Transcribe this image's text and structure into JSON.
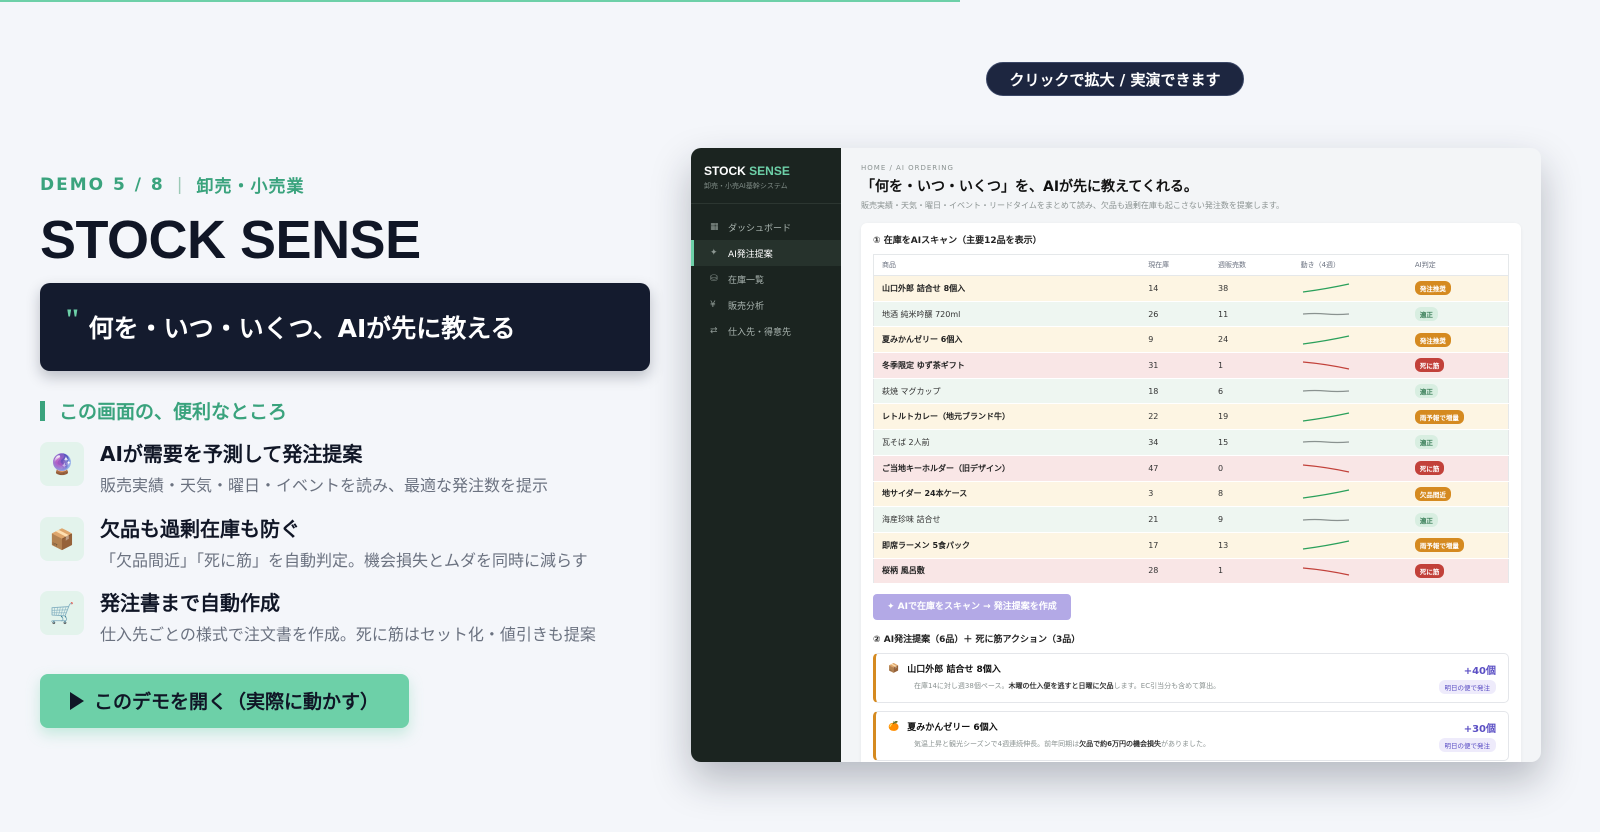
{
  "progress_fraction": 0.6,
  "left": {
    "eyebrow_demo": "DEMO 5 / 8",
    "eyebrow_sep": "|",
    "eyebrow_category": "卸売・小売業",
    "title": "STOCK SENSE",
    "quote_mark": "\"",
    "quote": "何を・いつ・いくつ、AIが先に教える",
    "section_title": "この画面の、便利なところ",
    "features": [
      {
        "icon": "crystal-ball-icon",
        "glyph": "🔮",
        "title": "AIが需要を予測して発注提案",
        "desc": "販売実績・天気・曜日・イベントを読み、最適な発注数を提示"
      },
      {
        "icon": "box-icon",
        "glyph": "📦",
        "title": "欠品も過剰在庫も防ぐ",
        "desc": "「欠品間近」「死に筋」を自動判定。機会損失とムダを同時に減らす"
      },
      {
        "icon": "cart-icon",
        "glyph": "🛒",
        "title": "発注書まで自動作成",
        "desc": "仕入先ごとの様式で注文書を作成。死に筋はセット化・値引きも提案"
      }
    ],
    "cta": "このデモを開く（実際に動かす）"
  },
  "tooltip": "クリックで拡大 / 実演できます",
  "app": {
    "brand_a": "STOCK",
    "brand_b": "SENSE",
    "brand_sub": "卸売・小売AI基幹システム",
    "nav": [
      {
        "icon": "▦",
        "label": "ダッシュボード",
        "active": false
      },
      {
        "icon": "✦",
        "label": "AI発注提案",
        "active": true
      },
      {
        "icon": "⛁",
        "label": "在庫一覧",
        "active": false
      },
      {
        "icon": "¥",
        "label": "販売分析",
        "active": false
      },
      {
        "icon": "⇄",
        "label": "仕入先・得意先",
        "active": false
      }
    ],
    "breadcrumb": "HOME / AI ORDERING",
    "heading": "「何を・いつ・いくつ」を、AIが先に教えてくれる。",
    "subheading": "販売実績・天気・曜日・イベント・リードタイムをまとめて読み、欠品も過剰在庫も起こさない発注数を提案します。",
    "scan_title": "① 在庫をAIスキャン（主要12品を表示）",
    "columns": [
      "商品",
      "現在庫",
      "週販売数",
      "動き（4週）",
      "AI判定"
    ],
    "rows": [
      {
        "name": "山口外郎 詰合せ 8個入",
        "stock": "14",
        "weekly": "38",
        "trend": "up",
        "status": "order",
        "label": "発注推奨"
      },
      {
        "name": "地酒 純米吟醸 720ml",
        "stock": "26",
        "weekly": "11",
        "trend": "flat",
        "status": "ok",
        "label": "適正"
      },
      {
        "name": "夏みかんゼリー 6個入",
        "stock": "9",
        "weekly": "24",
        "trend": "up",
        "status": "order",
        "label": "発注推奨"
      },
      {
        "name": "冬季限定 ゆず茶ギフト",
        "stock": "31",
        "weekly": "1",
        "trend": "down",
        "status": "dead",
        "label": "死に筋"
      },
      {
        "name": "萩焼 マグカップ",
        "stock": "18",
        "weekly": "6",
        "trend": "flat",
        "status": "ok",
        "label": "適正"
      },
      {
        "name": "レトルトカレー（地元ブランド牛）",
        "stock": "22",
        "weekly": "19",
        "trend": "up",
        "status": "rain",
        "label": "雨予報で増量"
      },
      {
        "name": "瓦そば 2人前",
        "stock": "34",
        "weekly": "15",
        "trend": "flat",
        "status": "ok",
        "label": "適正"
      },
      {
        "name": "ご当地キーホルダー（旧デザイン）",
        "stock": "47",
        "weekly": "0",
        "trend": "down",
        "status": "dead",
        "label": "死に筋"
      },
      {
        "name": "地サイダー 24本ケース",
        "stock": "3",
        "weekly": "8",
        "trend": "up",
        "status": "short",
        "label": "欠品間近"
      },
      {
        "name": "海産珍味 詰合せ",
        "stock": "21",
        "weekly": "9",
        "trend": "flat",
        "status": "ok",
        "label": "適正"
      },
      {
        "name": "即席ラーメン 5食パック",
        "stock": "17",
        "weekly": "13",
        "trend": "up",
        "status": "rain",
        "label": "雨予報で増量"
      },
      {
        "name": "桜柄 風呂敷",
        "stock": "28",
        "weekly": "1",
        "trend": "down",
        "status": "dead",
        "label": "死に筋"
      }
    ],
    "scan_button": "✦ AIで在庫をスキャン → 発注提案を作成",
    "proposal_title": "② AI発注提案（6品）＋ 死に筋アクション（3品）",
    "proposals": [
      {
        "glyph": "📦",
        "name": "山口外郎 詰合せ 8個入",
        "desc_a": "在庫14に対し週38個ペース。",
        "desc_b": "木曜の仕入便を逃すと日曜に欠品",
        "desc_c": "します。EC引当分も含めて算出。",
        "qty": "+40個",
        "tag": "明日の便で発注"
      },
      {
        "glyph": "🍊",
        "name": "夏みかんゼリー 6個入",
        "desc_a": "気温上昇と観光シーズンで4週連続伸長。前年同期は",
        "desc_b": "欠品で約6万円の機会損失",
        "desc_c": "がありました。",
        "qty": "+30個",
        "tag": "明日の便で発注"
      }
    ]
  },
  "colors": {
    "accent": "#6dd0a8",
    "navy": "#141b2e",
    "up": "#2aa05b",
    "flat": "#8a9290",
    "down": "#c2413a"
  }
}
